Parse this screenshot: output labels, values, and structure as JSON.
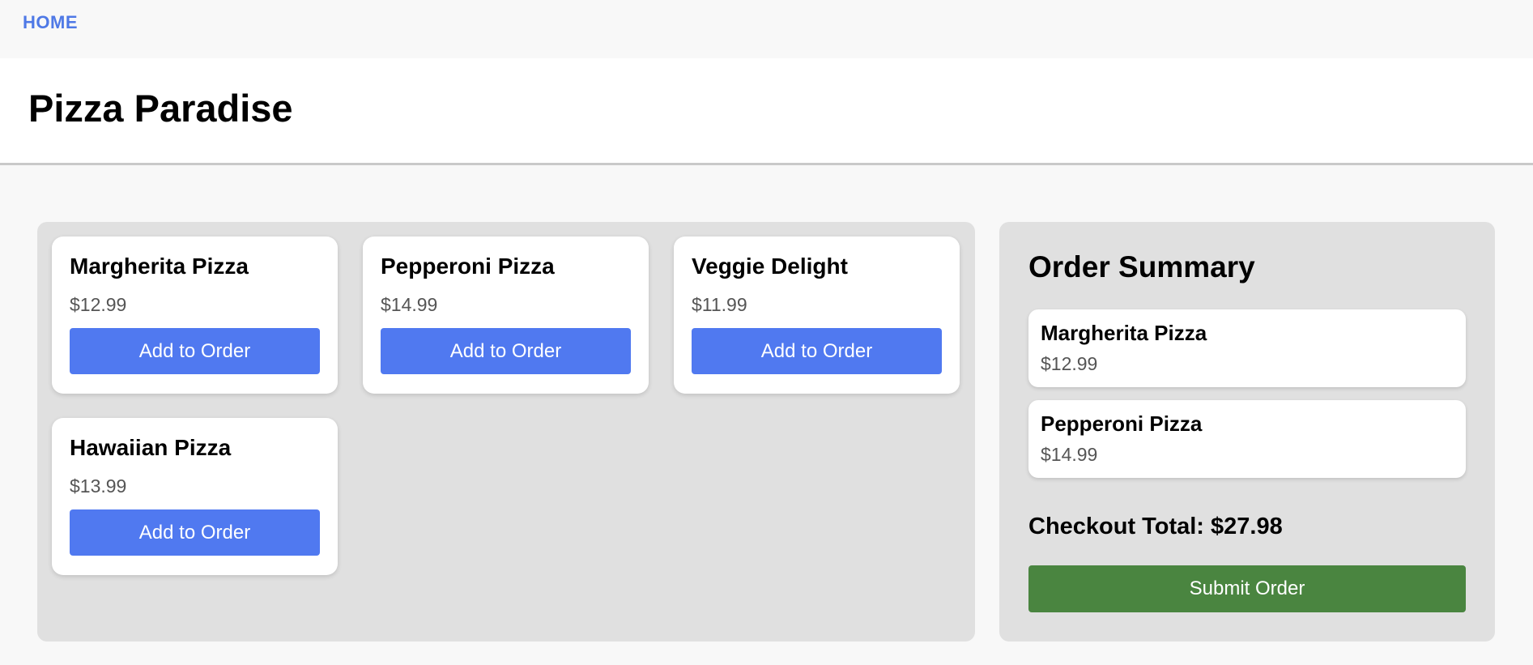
{
  "nav": {
    "home_label": "HOME"
  },
  "header": {
    "title": "Pizza Paradise"
  },
  "menu": {
    "items": [
      {
        "name": "Margherita Pizza",
        "price": "$12.99",
        "button_label": "Add to Order"
      },
      {
        "name": "Pepperoni Pizza",
        "price": "$14.99",
        "button_label": "Add to Order"
      },
      {
        "name": "Veggie Delight",
        "price": "$11.99",
        "button_label": "Add to Order"
      },
      {
        "name": "Hawaiian Pizza",
        "price": "$13.99",
        "button_label": "Add to Order"
      }
    ]
  },
  "summary": {
    "title": "Order Summary",
    "items": [
      {
        "name": "Margherita Pizza",
        "price": "$12.99"
      },
      {
        "name": "Pepperoni Pizza",
        "price": "$14.99"
      }
    ],
    "total_label": "Checkout Total: $27.98",
    "submit_label": "Submit Order"
  },
  "colors": {
    "accent": "#5079f0",
    "link": "#4f79e6",
    "submit": "#4a8540",
    "panel": "#e0e0e0"
  }
}
